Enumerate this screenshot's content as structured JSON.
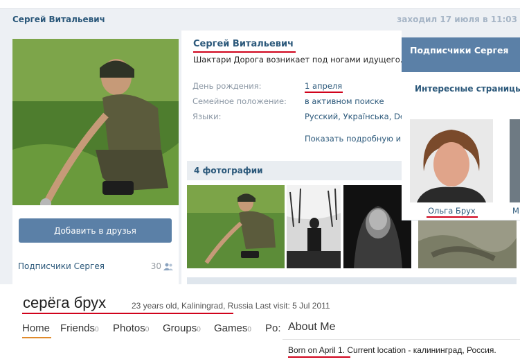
{
  "vk": {
    "header": {
      "name": "Сергей Витальевич",
      "last_seen": "заходил 17 июля в 11:03"
    },
    "left": {
      "add_friend_label": "Добавить в друзья",
      "subscribers_label": "Подписчики Сергея",
      "subscribers_count": "30"
    },
    "profile": {
      "name": "Сергей Витальевич",
      "status": "Шактари Дорога возникает под ногами идущего.",
      "rows": [
        {
          "label": "День рождения:",
          "value": "1 апреля"
        },
        {
          "label": "Семейное положение:",
          "value": "в активном поиске"
        },
        {
          "label": "Языки:",
          "value": "Русский, Українська, De"
        }
      ],
      "show_more": "Показать подробную ин"
    },
    "photos": {
      "header": "4 фотографии"
    },
    "side_panel": {
      "header": "Подписчики Сергея",
      "tab": "Интересные страницы",
      "follower_name": "Ольга Брух",
      "follower2_initial": "М"
    },
    "colors": {
      "accent": "#5b80a7",
      "link": "#2b587a",
      "annotation": "#d0021b"
    }
  },
  "other_profile": {
    "name": "серёга брух",
    "meta_age_city": "23 years old, Kaliningrad",
    "meta_rest": ", Russia Last visit: 5 Jul 2011",
    "nav": [
      {
        "label": "Home",
        "count": ""
      },
      {
        "label": "Friends",
        "count": "0"
      },
      {
        "label": "Photos",
        "count": "0"
      },
      {
        "label": "Groups",
        "count": "0"
      },
      {
        "label": "Games",
        "count": "0"
      },
      {
        "label": "Po:",
        "count": ""
      }
    ],
    "about_header": "About Me",
    "about_born": "Born on April 1",
    "about_rest": ". Current location - калининград, Россия."
  }
}
